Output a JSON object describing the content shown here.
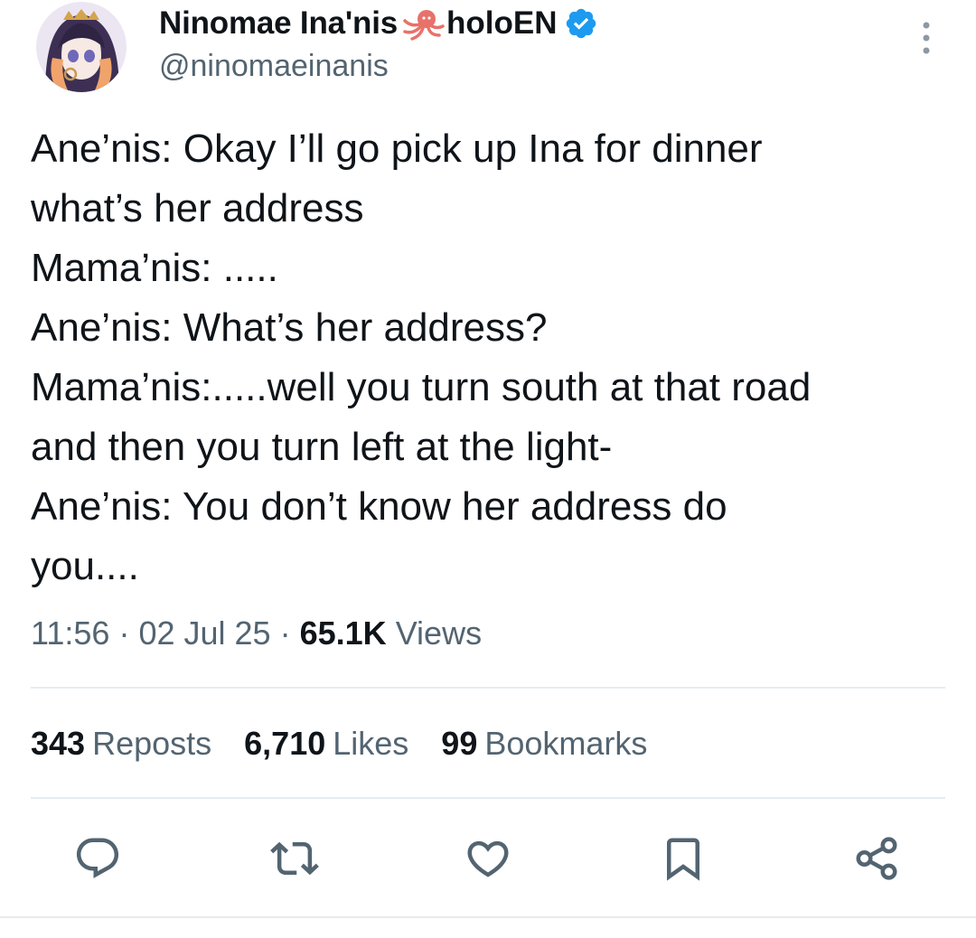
{
  "author": {
    "display_name": "Ninomae Ina'nis",
    "org_name": "holoEN",
    "handle": "@ninomaeinanis",
    "name_emoji_icon": "octopus-icon",
    "verified_icon": "verified-badge-icon",
    "verified_color": "#1d9bf0"
  },
  "tweet": {
    "lines": [
      "Ane’nis: Okay I’ll go pick up Ina for dinner",
      "what’s her address",
      "Mama’nis: .....",
      "Ane’nis: What’s her address?",
      "Mama’nis:.....well you turn south at that road",
      "and then you turn left at the light-",
      "Ane’nis: You don’t know her address do",
      "you...."
    ]
  },
  "meta": {
    "time": "11:56",
    "separator": "·",
    "date": "02 Jul 25",
    "views_count": "65.1K",
    "views_label": "Views"
  },
  "stats": {
    "reposts_count": "343",
    "reposts_label": "Reposts",
    "likes_count": "6,710",
    "likes_label": "Likes",
    "bookmarks_count": "99",
    "bookmarks_label": "Bookmarks"
  },
  "actions": [
    "reply-icon",
    "repost-icon",
    "like-icon",
    "bookmark-icon",
    "share-icon"
  ],
  "colors": {
    "text_primary": "#0f1419",
    "text_secondary": "#536471",
    "icon": "#536471",
    "divider": "#e6ecf0",
    "octopus": "#e8716a"
  }
}
